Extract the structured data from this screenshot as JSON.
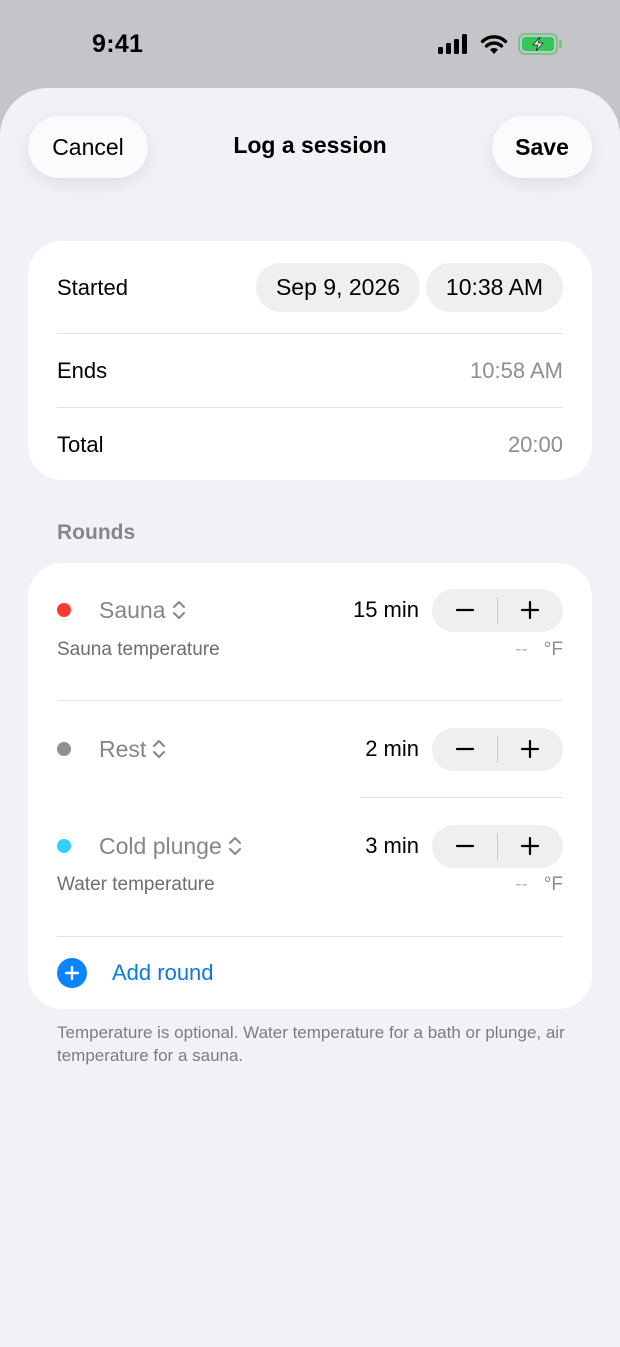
{
  "status_bar": {
    "time": "9:41"
  },
  "header": {
    "cancel_label": "Cancel",
    "title": "Log a session",
    "save_label": "Save"
  },
  "time_card": {
    "started_label": "Started",
    "started_date": "Sep 9, 2026",
    "started_time": "10:38 AM",
    "ends_label": "Ends",
    "ends_value": "10:58 AM",
    "total_label": "Total",
    "total_value": "20:00"
  },
  "rounds": {
    "section_title": "Rounds",
    "items": [
      {
        "type": "Sauna",
        "color": "#ff3b30",
        "duration": "15 min",
        "temp_label": "Sauna temperature",
        "temp_value": "--",
        "temp_unit": "°F"
      },
      {
        "type": "Rest",
        "color": "#8e8e93",
        "duration": "2 min"
      },
      {
        "type": "Cold plunge",
        "color": "#32d0ff",
        "duration": "3 min",
        "temp_label": "Water temperature",
        "temp_value": "--",
        "temp_unit": "°F"
      }
    ],
    "add_label": "Add round",
    "footnote": "Temperature is optional. Water temperature for a bath or plunge, air temperature for a sauna."
  },
  "colors": {
    "accent": "#0a84ff",
    "battery": "#34c759"
  }
}
